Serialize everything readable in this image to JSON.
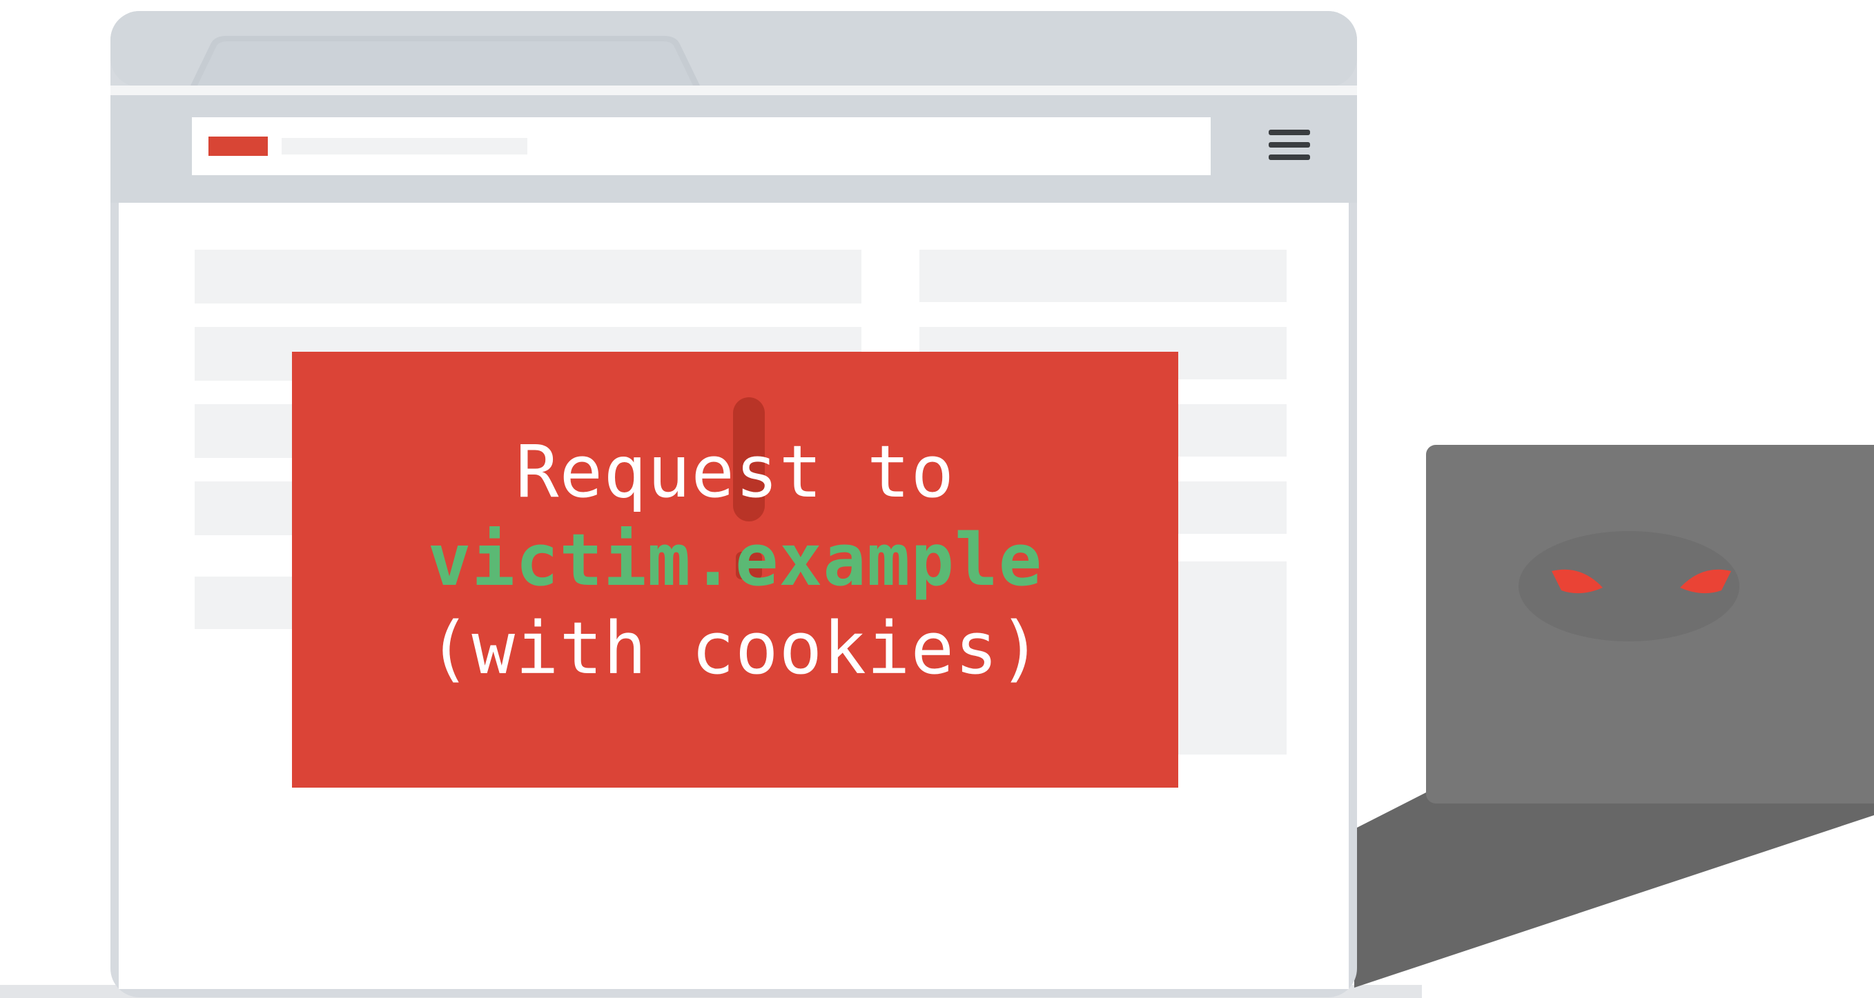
{
  "browser": {
    "menu_icon": "hamburger-menu-icon",
    "address_bar_indicator_color": "#d84535"
  },
  "alert": {
    "line1": "Request to",
    "domain": "victim.example",
    "line3": "(with cookies)",
    "background_color": "#db4437",
    "domain_color": "#5bb974",
    "exclamation_icon": "exclamation-icon"
  },
  "attacker": {
    "eyes_icon": "glowing-eyes-icon",
    "laptop_color": "#777777",
    "eye_color": "#ea4335"
  }
}
